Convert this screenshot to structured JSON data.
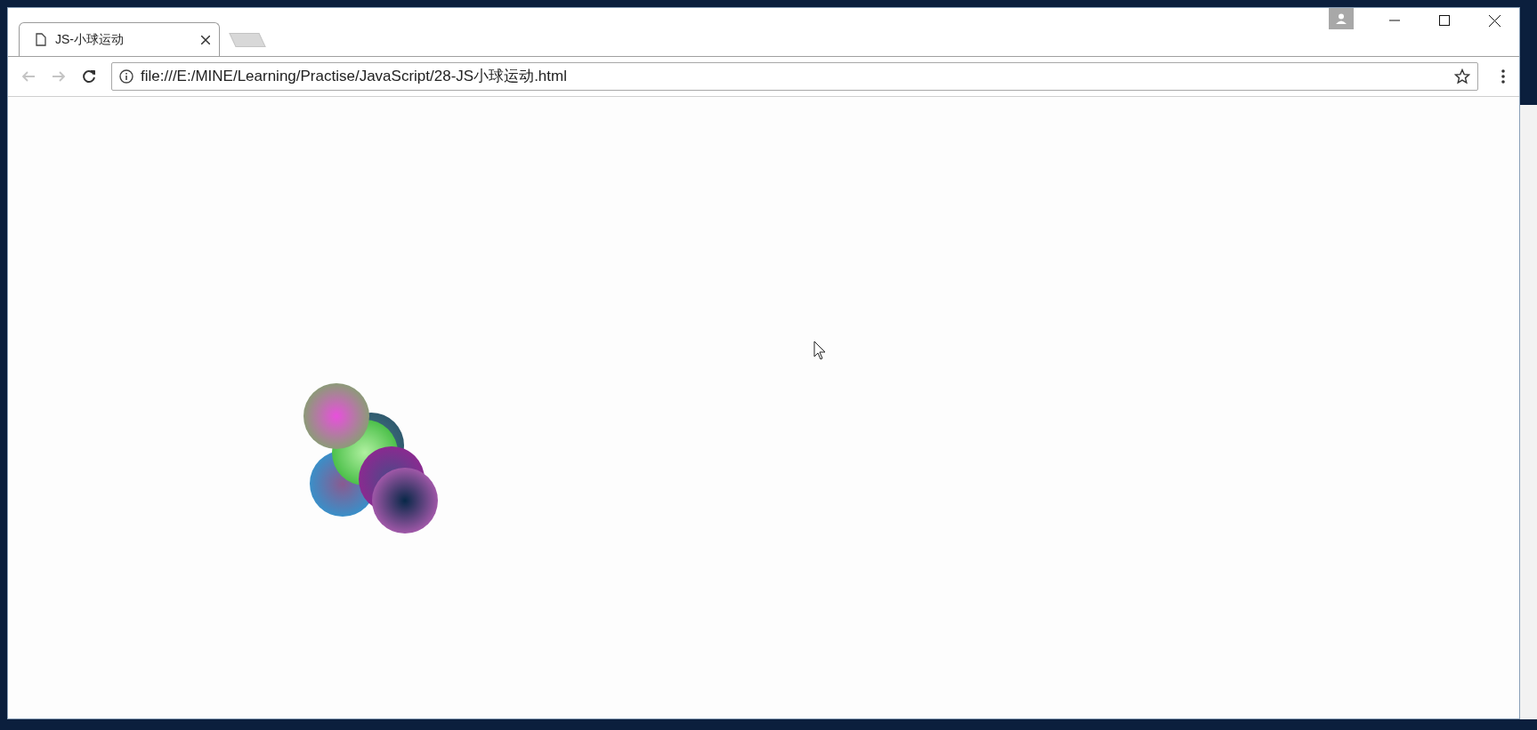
{
  "tabs": [
    {
      "title": "JS-小球运动",
      "selected": true
    }
  ],
  "nav_buttons": [
    {
      "kind": "back",
      "disabled": true
    },
    {
      "kind": "forward",
      "disabled": true
    },
    {
      "kind": "reload",
      "disabled": false
    }
  ],
  "address_bar": {
    "url": "file:///E:/MINE/Learning/Practise/JavaScript/28-JS小球运动.html"
  }
}
